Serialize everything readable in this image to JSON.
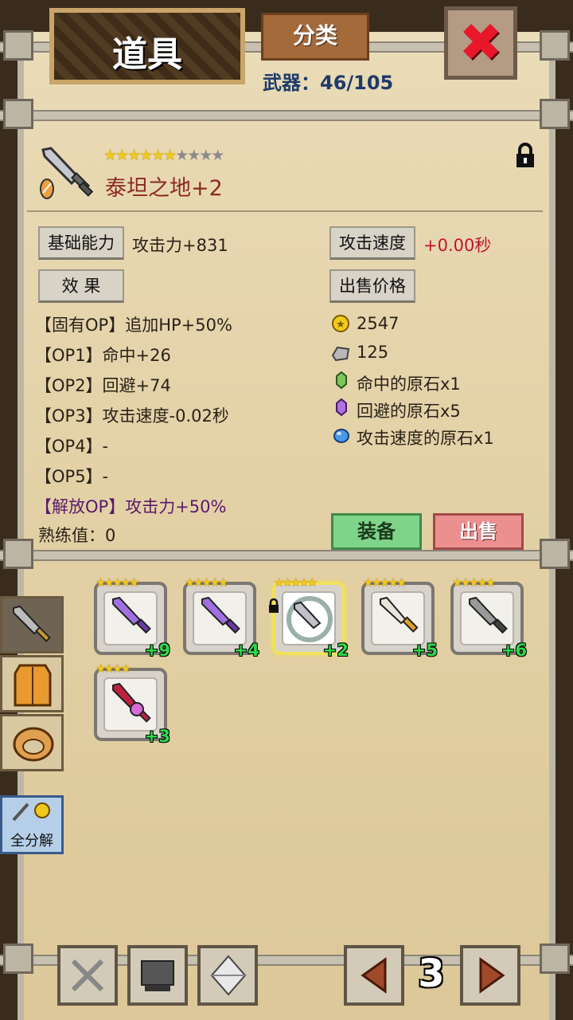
{
  "header": {
    "title": "道具",
    "category_label": "分类",
    "count_text": "武器：46/105"
  },
  "item": {
    "name": "泰坦之地+2",
    "stars_filled": 6,
    "stars_total": 10,
    "locked": true,
    "basic_label": "基础能力",
    "basic_value": "攻击力+831",
    "speed_label": "攻击速度",
    "speed_value": "+0.00秒",
    "effect_label": "效 果",
    "price_label": "出售价格",
    "options": [
      "【固有OP】追加HP+50%",
      "【OP1】命中+26",
      "【OP2】回避+74",
      "【OP3】攻击速度-0.02秒",
      "【OP4】-",
      "【OP5】-"
    ],
    "unlock_option": "【解放OP】攻击力+50%",
    "proficiency": "熟练值：0",
    "price": {
      "gold": "2547",
      "stone": "125",
      "materials": [
        "命中的原石x1",
        "回避的原石x5",
        "攻击速度的原石x1"
      ]
    },
    "equip_label": "装备",
    "sell_label": "出售"
  },
  "inventory": [
    {
      "level": "+9",
      "color": "#8a5ad8"
    },
    {
      "level": "+4",
      "color": "#8a5ad8"
    },
    {
      "level": "+2",
      "color": "#444444"
    },
    {
      "level": "+5",
      "color": "#e0a020"
    },
    {
      "level": "+6",
      "color": "#555555"
    },
    {
      "level": "+3",
      "color": "#c02040"
    }
  ],
  "side": {
    "disassemble_label": "全分解"
  },
  "pager": {
    "page": "3"
  },
  "colors": {
    "accent_red": "#c01530",
    "equip_green": "#7fd48a",
    "sell_pink": "#eb8f8f",
    "count_blue": "#1e3a6a"
  }
}
